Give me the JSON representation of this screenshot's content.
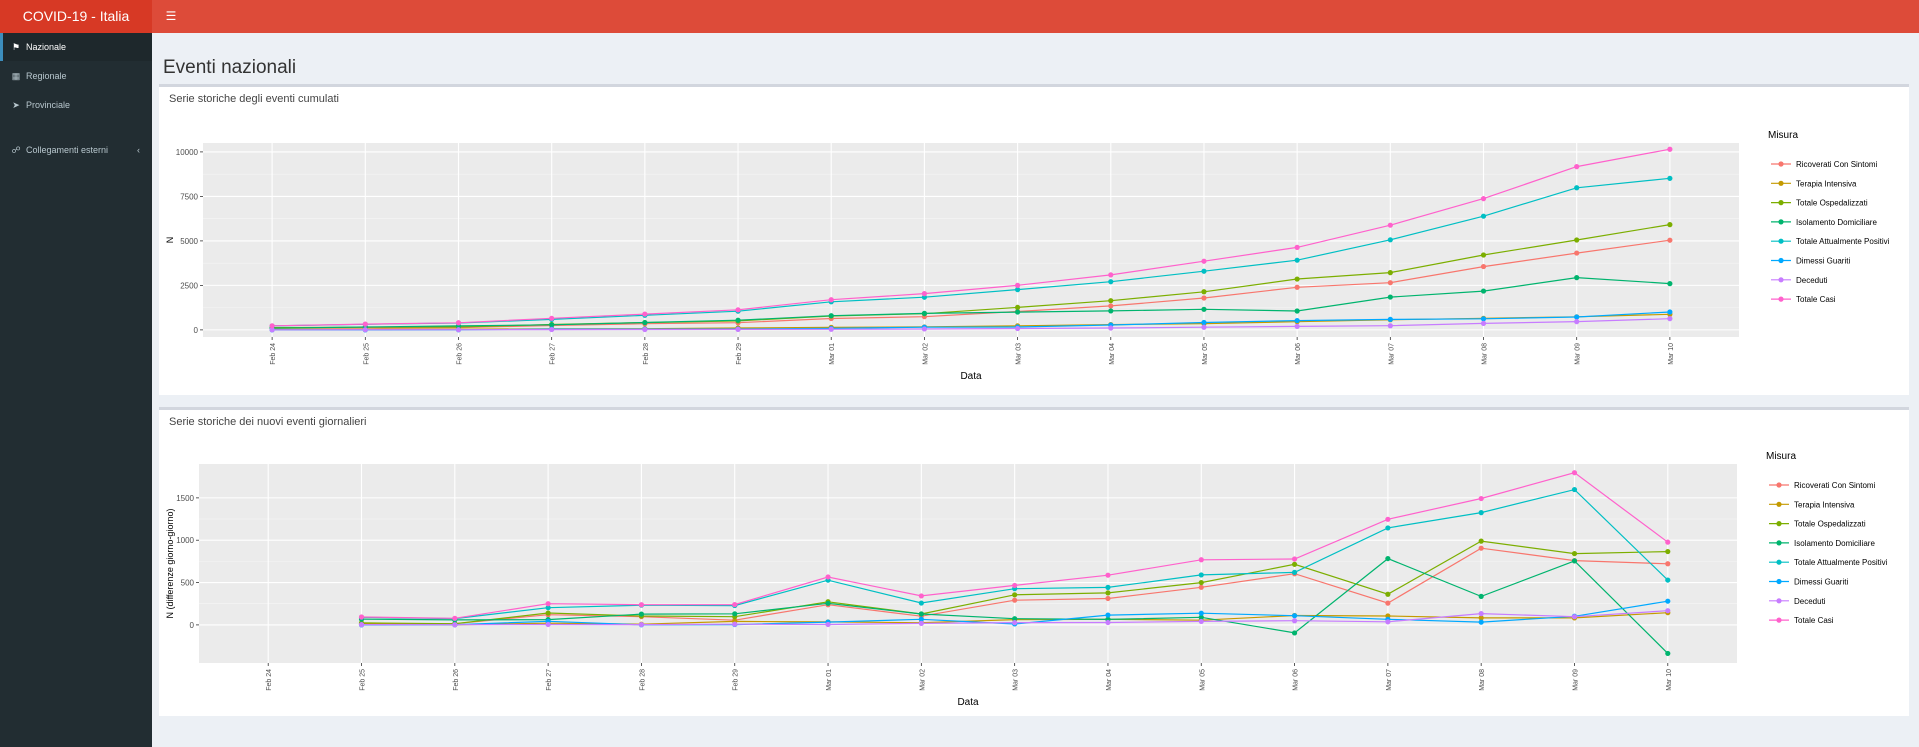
{
  "app": {
    "title": "COVID-19 - Italia",
    "menu_icon": "bars-icon"
  },
  "sidebar": {
    "items": [
      {
        "label": "Nazionale",
        "icon": "flag-icon",
        "active": true
      },
      {
        "label": "Regionale",
        "icon": "map-icon",
        "active": false
      },
      {
        "label": "Provinciale",
        "icon": "location-arrow-icon",
        "active": false
      },
      {
        "label": "Collegamenti esterni",
        "icon": "link-icon",
        "active": false,
        "expand_icon": "chevron-left-icon"
      }
    ]
  },
  "page": {
    "title": "Eventi nazionali"
  },
  "colors": {
    "header": "#dd4b39",
    "brand": "#d73925",
    "sidebar": "#222d32",
    "panel": "#ebebeb",
    "grid": "#ffffff",
    "series": [
      "#f8766d",
      "#c49a00",
      "#7cae00",
      "#00b46e",
      "#00bfc4",
      "#00a9ff",
      "#c77cff",
      "#ff61cc"
    ]
  },
  "panels": [
    {
      "title": "Serie storiche degli eventi cumulati",
      "chart_data": {
        "type": "line",
        "xlabel": "Data",
        "ylabel": "N",
        "ylim": [
          -400,
          10500
        ],
        "yticks": [
          0,
          2500,
          5000,
          7500,
          10000
        ],
        "ytick_labels": [
          "0",
          "2500",
          "5000",
          "7500",
          "10000"
        ],
        "categories": [
          "Feb 24",
          "Feb 25",
          "Feb 26",
          "Feb 27",
          "Feb 28",
          "Feb 29",
          "Mar 01",
          "Mar 02",
          "Mar 03",
          "Mar 04",
          "Mar 05",
          "Mar 06",
          "Mar 07",
          "Mar 08",
          "Mar 09",
          "Mar 10"
        ],
        "legend_title": "Misura",
        "legend_position": "right",
        "series": [
          {
            "name": "Ricoverati Con Sintomi",
            "values": [
              101,
              114,
              128,
              248,
              345,
              401,
              639,
              742,
              1034,
              1346,
              1790,
              2394,
              2651,
              3557,
              4316,
              5038
            ]
          },
          {
            "name": "Terapia Intensiva",
            "values": [
              26,
              35,
              36,
              56,
              64,
              105,
              140,
              166,
              229,
              295,
              351,
              462,
              567,
              650,
              733,
              877
            ]
          },
          {
            "name": "Totale Ospedalizzati",
            "values": [
              127,
              150,
              164,
              304,
              409,
              506,
              779,
              908,
              1263,
              1641,
              2141,
              2856,
              3218,
              4207,
              5049,
              5915
            ]
          },
          {
            "name": "Isolamento Domiciliare",
            "values": [
              94,
              162,
              221,
              284,
              412,
              543,
              798,
              927,
              1000,
              1065,
              1155,
              1060,
              1843,
              2180,
              2936,
              2599
            ]
          },
          {
            "name": "Totale Attualmente Positivi",
            "values": [
              221,
              311,
              385,
              588,
              821,
              1049,
              1577,
              1835,
              2263,
              2706,
              3296,
              3916,
              5061,
              6387,
              7985,
              8514
            ]
          },
          {
            "name": "Dimessi Guariti",
            "values": [
              1,
              1,
              3,
              45,
              46,
              50,
              83,
              149,
              160,
              276,
              414,
              523,
              589,
              622,
              724,
              1004
            ]
          },
          {
            "name": "Deceduti",
            "values": [
              7,
              10,
              12,
              17,
              21,
              29,
              34,
              52,
              79,
              107,
              148,
              197,
              233,
              366,
              463,
              631
            ]
          },
          {
            "name": "Totale Casi",
            "values": [
              229,
              322,
              400,
              650,
              888,
              1128,
              1694,
              2036,
              2502,
              3089,
              3858,
              4636,
              5883,
              7375,
              9172,
              10149
            ]
          }
        ]
      }
    },
    {
      "title": "Serie storiche dei nuovi eventi giornalieri",
      "chart_data": {
        "type": "line",
        "xlabel": "Data",
        "ylabel": "N (differenze giorno-giorno)",
        "ylim": [
          -450,
          1900
        ],
        "yticks": [
          0,
          500,
          1000,
          1500
        ],
        "ytick_labels": [
          "0",
          "500",
          "1000",
          "1500"
        ],
        "categories": [
          "Feb 24",
          "Feb 25",
          "Feb 26",
          "Feb 27",
          "Feb 28",
          "Feb 29",
          "Mar 01",
          "Mar 02",
          "Mar 03",
          "Mar 04",
          "Mar 05",
          "Mar 06",
          "Mar 07",
          "Mar 08",
          "Mar 09",
          "Mar 10"
        ],
        "legend_title": "Misura",
        "legend_position": "right",
        "series": [
          {
            "name": "Ricoverati Con Sintomi",
            "values": [
              null,
              13,
              14,
              120,
              97,
              56,
              238,
              103,
              292,
              312,
              444,
              604,
              257,
              906,
              759,
              722
            ]
          },
          {
            "name": "Terapia Intensiva",
            "values": [
              null,
              9,
              1,
              20,
              8,
              41,
              35,
              26,
              63,
              66,
              56,
              111,
              105,
              83,
              83,
              144
            ]
          },
          {
            "name": "Totale Ospedalizzati",
            "values": [
              null,
              23,
              14,
              140,
              105,
              97,
              273,
              129,
              355,
              378,
              500,
              715,
              362,
              989,
              842,
              866
            ]
          },
          {
            "name": "Isolamento Domiciliare",
            "values": [
              null,
              68,
              59,
              63,
              128,
              131,
              255,
              129,
              73,
              65,
              90,
              -95,
              783,
              337,
              756,
              -337
            ]
          },
          {
            "name": "Totale Attualmente Positivi",
            "values": [
              null,
              90,
              74,
              203,
              233,
              228,
              528,
              258,
              428,
              443,
              590,
              620,
              1145,
              1326,
              1598,
              529
            ]
          },
          {
            "name": "Dimessi Guariti",
            "values": [
              null,
              0,
              2,
              42,
              1,
              4,
              33,
              66,
              11,
              116,
              138,
              109,
              66,
              33,
              102,
              280
            ]
          },
          {
            "name": "Deceduti",
            "values": [
              null,
              3,
              2,
              5,
              4,
              8,
              5,
              18,
              27,
              28,
              41,
              49,
              36,
              133,
              97,
              168
            ]
          },
          {
            "name": "Totale Casi",
            "values": [
              null,
              93,
              78,
              250,
              238,
              240,
              566,
              342,
              466,
              587,
              769,
              778,
              1247,
              1492,
              1797,
              977
            ]
          }
        ]
      }
    }
  ]
}
